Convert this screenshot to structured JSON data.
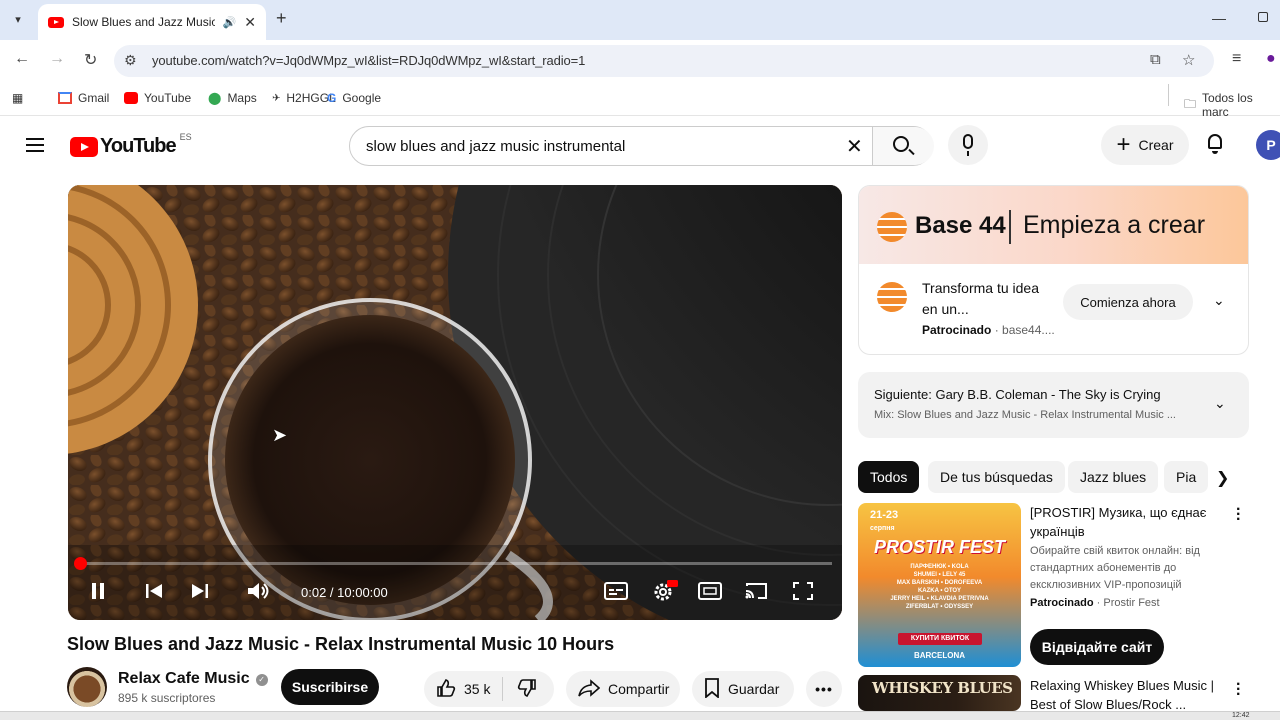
{
  "browser": {
    "tab_title": "Slow Blues and Jazz Music - Relax",
    "url": "youtube.com/watch?v=Jq0dWMpz_wI&list=RDJq0dWMpz_wI&start_radio=1",
    "bookmarks": [
      "Gmail",
      "YouTube",
      "Maps",
      "H2HGGL",
      "Google"
    ],
    "bookmarks_folder": "Todos los marc"
  },
  "header": {
    "logo_text": "YouTube",
    "country_code": "ES",
    "search_value": "slow blues and jazz music instrumental",
    "create_label": "Crear",
    "avatar_letter": "P"
  },
  "player": {
    "time": "0:02 / 10:00:00",
    "progress_fraction": 0.0
  },
  "video": {
    "title": "Slow Blues and Jazz Music - Relax Instrumental Music 10 Hours",
    "channel_name": "Relax Cafe Music",
    "subscribers": "895 k suscriptores",
    "subscribe_label": "Suscribirse",
    "likes": "35 k",
    "share_label": "Compartir",
    "save_label": "Guardar"
  },
  "ad": {
    "brand": "Base 44",
    "slogan": "Empieza a crear",
    "headline": "Transforma tu idea en un...",
    "sponsored": "Patrocinado",
    "domain": "base44....",
    "cta": "Comienza ahora"
  },
  "up_next": {
    "label": "Siguiente:",
    "title": "Gary B.B. Coleman - The Sky is Crying",
    "playlist": "Mix: Slow Blues and Jazz Music - Relax Instrumental Music ..."
  },
  "chips": [
    "Todos",
    "De tus búsquedas",
    "Jazz blues",
    "Pia"
  ],
  "recommendations": [
    {
      "title": "[PROSTIR] Музика, що єднає українців",
      "description": "Обирайте свій квиток онлайн: від стандартних абонементів до ексклюзивних VIP-пропозицій",
      "sponsored": "Patrocinado",
      "sponsor_name": "Prostir Fest",
      "cta": "Відвідайте сайт",
      "thumb": {
        "dates": "21-23",
        "month": "серпня",
        "name": "PROSTIR FEST",
        "lineup": [
          "ПАРФЕНЮК • KOLA",
          "SHUMEI • LELY 45",
          "MAX BARSKIH • DOROFEEVA",
          "KAZKA • OTOY",
          "JERRY HEIL • KLAVDIA PETRIVNA",
          "ZIFERBLAT • ODYSSEY"
        ],
        "ticket": "КУПИТИ КВИТОК",
        "city": "BARCELONA"
      }
    },
    {
      "title": "Relaxing Whiskey Blues Music | Best of Slow Blues/Rock ...",
      "thumb": {
        "text": "WHISKEY BLUES"
      }
    }
  ],
  "taskbar": {
    "clock": "12:42"
  }
}
